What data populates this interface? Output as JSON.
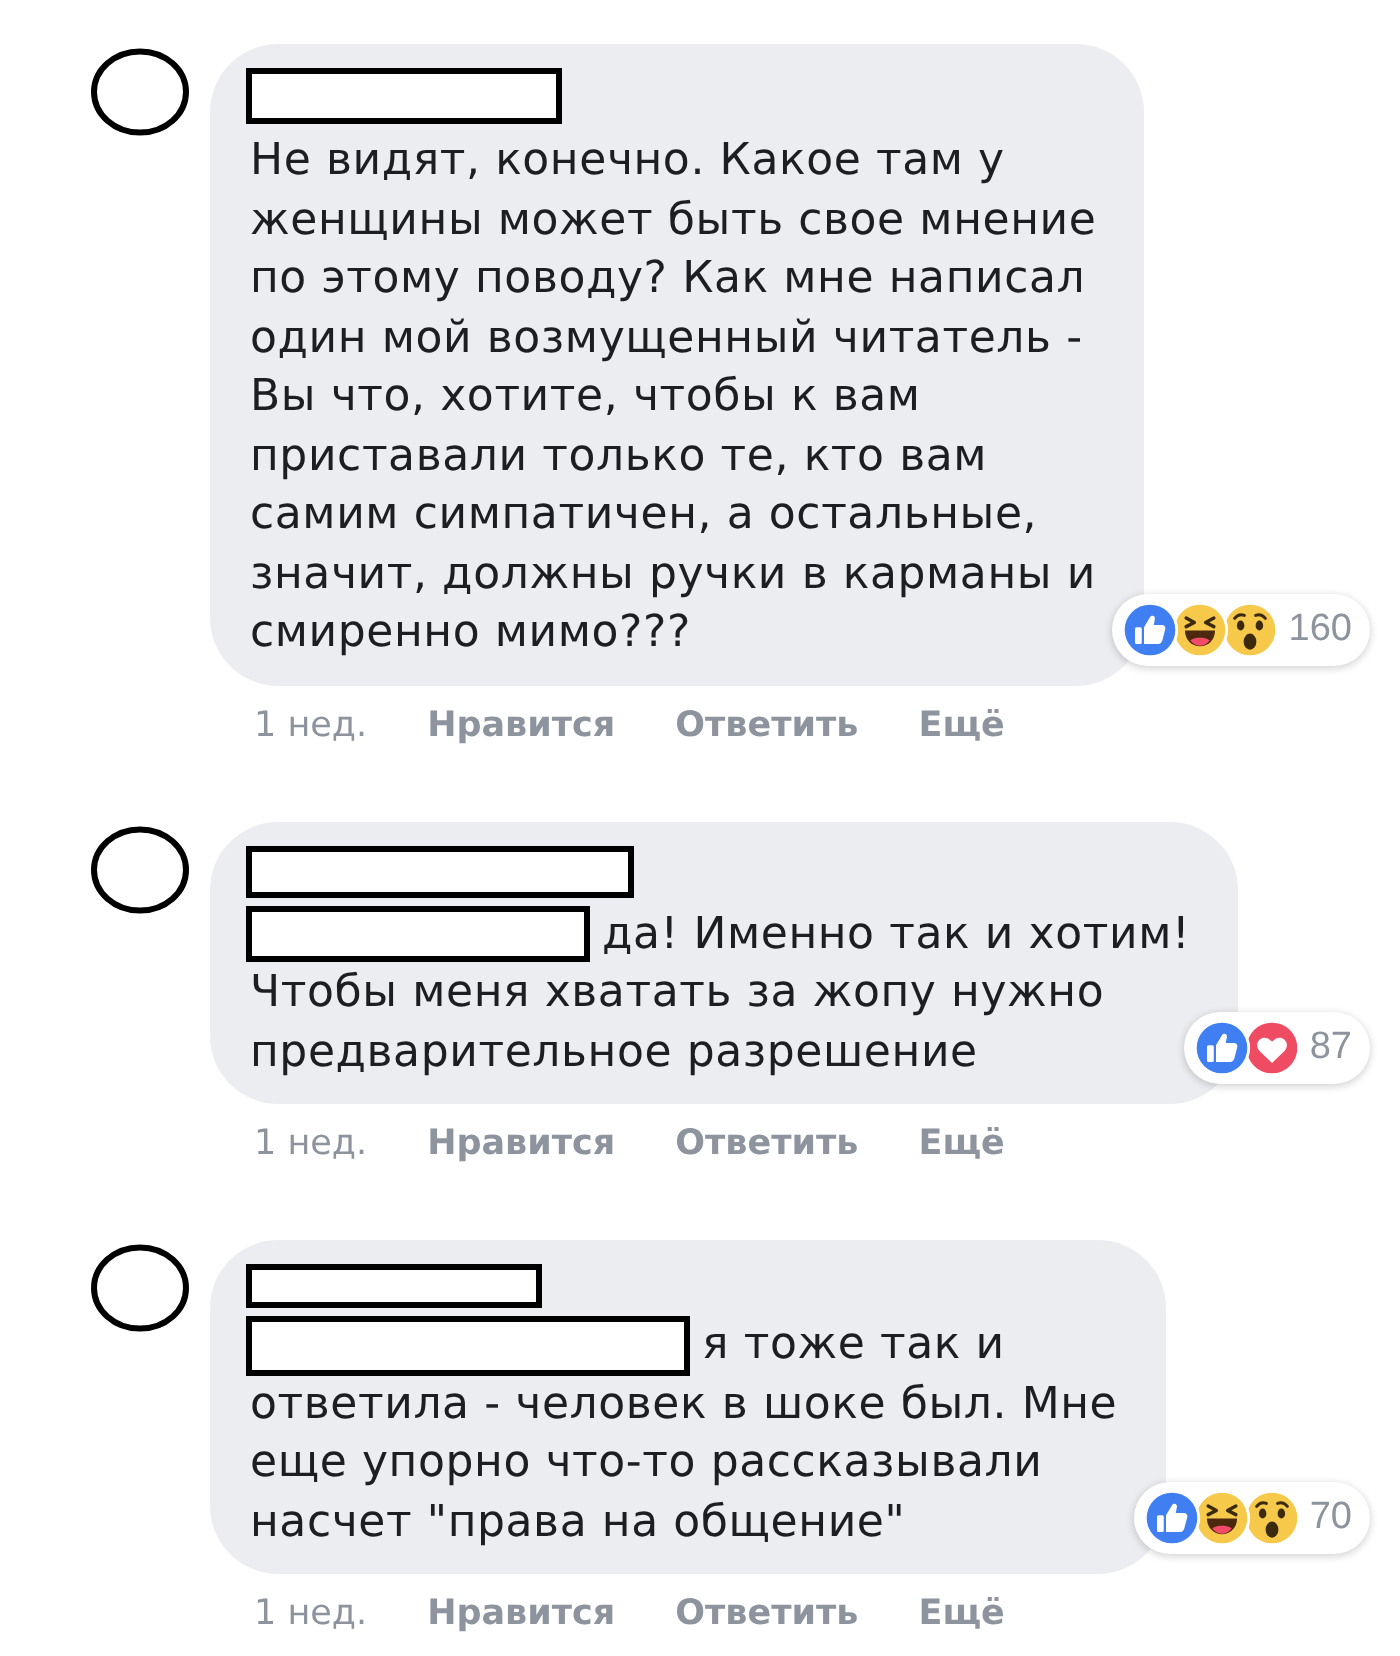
{
  "comments": [
    {
      "author_redacted": true,
      "mention_redacted": false,
      "text": "Не видят, конечно. Какое там у\nженщины может быть свое мнение\nпо этому поводу? Как мне написал\nодин мой возмущенный читатель -\nВы что, хотите, чтобы к вам\nприставали только те, кто вам\nсамим симпатичен, а остальные,\nзначит, должны ручки в карманы и\nсмиренно мимо???",
      "reactions": [
        {
          "kind": "like"
        },
        {
          "kind": "haha"
        },
        {
          "kind": "wow"
        }
      ],
      "reaction_count": "160",
      "time": "1 нед.",
      "actions": [
        "Нравится",
        "Ответить",
        "Ещё"
      ]
    },
    {
      "author_redacted": true,
      "mention_redacted": true,
      "text": "да! Именно так и хотим!\nЧтобы меня хватать за жопу нужно\nпредварительное разрешение",
      "reactions": [
        {
          "kind": "like"
        },
        {
          "kind": "love"
        }
      ],
      "reaction_count": "87",
      "time": "1 нед.",
      "actions": [
        "Нравится",
        "Ответить",
        "Ещё"
      ]
    },
    {
      "author_redacted": true,
      "mention_redacted": true,
      "text": "я тоже так и\nответила - человек в шоке был. Мне\nеще упорно что-то рассказывали\nнасчет \"права на общение\"",
      "reactions": [
        {
          "kind": "like"
        },
        {
          "kind": "haha"
        },
        {
          "kind": "wow"
        }
      ],
      "reaction_count": "70",
      "time": "1 нед.",
      "actions": [
        "Нравится",
        "Ответить",
        "Ещё"
      ]
    }
  ]
}
